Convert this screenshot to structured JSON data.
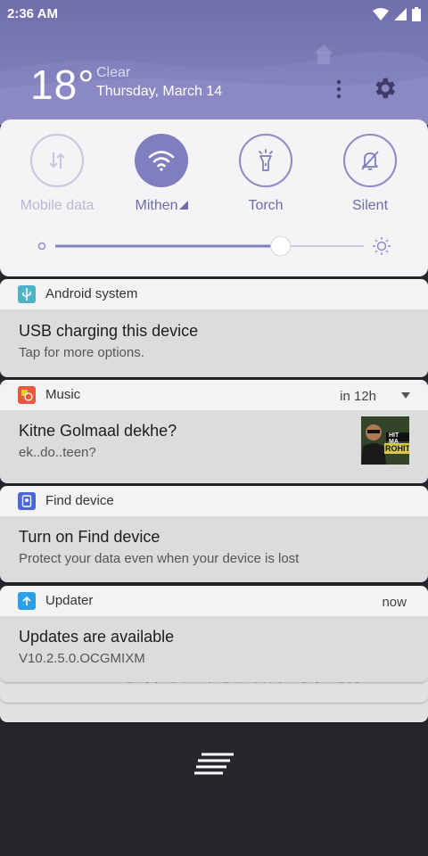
{
  "status_bar": {
    "time": "2:36 AM",
    "icons": [
      "wifi-icon",
      "signal-icon",
      "battery-icon"
    ]
  },
  "weather": {
    "temperature": "18°",
    "condition": "Clear",
    "date": "Thursday, March 14"
  },
  "header_actions": {
    "more_icon": "more-vertical-icon",
    "settings_icon": "gear-icon"
  },
  "quick_settings": {
    "tiles": [
      {
        "label": "Mobile data",
        "state": "off",
        "icon": "mobile-data-icon"
      },
      {
        "label": "Mithen",
        "state": "on",
        "icon": "wifi-icon",
        "has_dropdown": true
      },
      {
        "label": "Torch",
        "state": "off-active",
        "icon": "flashlight-icon"
      },
      {
        "label": "Silent",
        "state": "off-active",
        "icon": "bell-off-icon"
      }
    ],
    "brightness_level": 0.73
  },
  "notifications": [
    {
      "app": "Android system",
      "title": "USB charging this device",
      "text": "Tap for more options.",
      "icon": "usb-icon",
      "icon_color": "#4fb3c8"
    },
    {
      "app": "Music",
      "time": "in 12h",
      "title": "Kitne Golmaal dekhe?",
      "text": "ek..do..teen?",
      "icon": "music-app-icon",
      "icon_color": "#e85a3a",
      "thumbnail_text": [
        "HIT MA",
        "ROHIT S"
      ]
    },
    {
      "app": "Find device",
      "title": "Turn on Find device",
      "text": "Protect your data even when your device is lost",
      "icon": "find-device-icon",
      "icon_color": "#4a69d6"
    },
    {
      "app": "Updater",
      "time": "now",
      "title": "Updates are available",
      "text": "V10.2.5.0.OCGMIXM",
      "icon": "update-icon",
      "icon_color": "#2d9ee8"
    }
  ],
  "stacked_notification": {
    "text": "13800000000 您好，快递帮您放收发室了，记得..."
  },
  "footer": {
    "clear_icon": "clear-all-icon"
  }
}
